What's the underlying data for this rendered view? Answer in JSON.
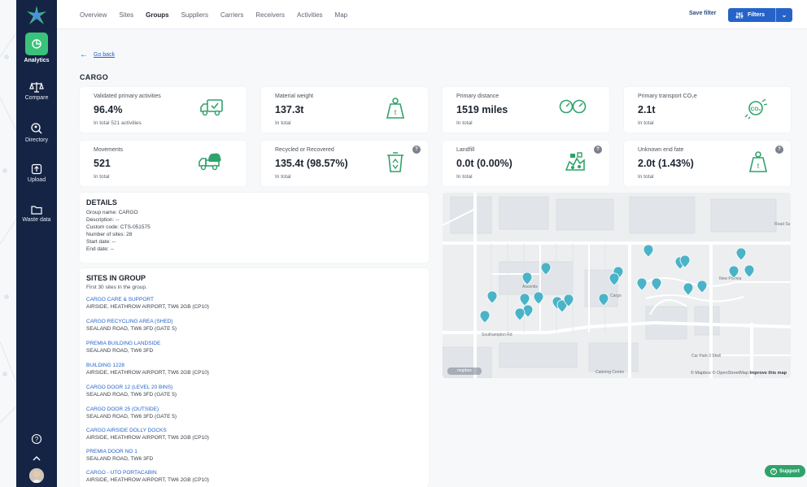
{
  "sidebar": {
    "items": [
      {
        "label": "Analytics",
        "icon": "analytics-icon",
        "active": true
      },
      {
        "label": "Compare",
        "icon": "compare-scale-icon"
      },
      {
        "label": "Directory",
        "icon": "directory-search-icon"
      },
      {
        "label": "Upload",
        "icon": "upload-icon"
      },
      {
        "label": "Waste data",
        "icon": "folder-icon"
      }
    ],
    "help_icon": "help-circle-icon",
    "collapse_icon": "chevron-up-icon"
  },
  "topnav": {
    "tabs": [
      "Overview",
      "Sites",
      "Groups",
      "Suppliers",
      "Carriers",
      "Receivers",
      "Activities",
      "Map"
    ],
    "active_tab": "Groups",
    "save_filter": "Save filter",
    "filters": "Filters"
  },
  "page": {
    "go_back": "Go back",
    "title": "CARGO"
  },
  "kpis": [
    {
      "label": "Validated primary activities",
      "value": "96.4%",
      "sub": "In total 521 activities",
      "icon": "truck-check-icon",
      "help": false
    },
    {
      "label": "Material weight",
      "value": "137.3t",
      "sub": "In total",
      "icon": "weight-icon",
      "help": false
    },
    {
      "label": "Primary distance",
      "value": "1519 miles",
      "sub": "In total",
      "icon": "gauge-icon",
      "help": false
    },
    {
      "label": "Primary transport CO₂e",
      "value": "2.1t",
      "sub": "In total",
      "icon": "co2-icon",
      "help": false
    },
    {
      "label": "Movements",
      "value": "521",
      "sub": "In total",
      "icon": "truck-cargo-icon",
      "help": false
    },
    {
      "label": "Recycled or Recovered",
      "value": "135.4t (98.57%)",
      "sub": "In total",
      "icon": "recycle-bin-icon",
      "help": true
    },
    {
      "label": "Landfill",
      "value": "0.0t (0.00%)",
      "sub": "In total",
      "icon": "landfill-icon",
      "help": true
    },
    {
      "label": "Unknown end fate",
      "value": "2.0t (1.43%)",
      "sub": "In total",
      "icon": "weight-icon",
      "help": true
    }
  ],
  "details": {
    "title": "DETAILS",
    "lines": [
      "Group name: CARGO",
      "Description: --",
      "Custom code: CTS-051575",
      "Number of sites: 28",
      "Start date: --",
      "End date: --"
    ]
  },
  "sites": {
    "title": "SITES IN GROUP",
    "subtitle": "First 30 sites in the group.",
    "items": [
      {
        "name": "CARGO CARE & SUPPORT",
        "address": "AIRSIDE, HEATHROW AIRPORT, TW6 2GB (CP10)"
      },
      {
        "name": "CARGO RECYCLING AREA (SHED)",
        "address": "SEALAND ROAD, TW6 3FD (GATE 5)"
      },
      {
        "name": "PREMIA BUILDING LANDSIDE",
        "address": "SEALAND ROAD, TW6 3FD"
      },
      {
        "name": "BUILDING 1228",
        "address": "AIRSIDE, HEATHROW AIRPORT, TW6 2GB (CP10)"
      },
      {
        "name": "CARGO DOOR 12 (LEVEL 20 BINS)",
        "address": "SEALAND ROAD, TW6 3FD (GATE 5)"
      },
      {
        "name": "CARGO DOOR 25 (OUTSIDE)",
        "address": "SEALAND ROAD, TW6 3FD (GATE 5)"
      },
      {
        "name": "CARGO AIRSIDE DOLLY DOCKS",
        "address": "AIRSIDE, HEATHROW AIRPORT, TW6 2GB (CP10)"
      },
      {
        "name": "PREMIA DOOR NO 1",
        "address": "SEALAND ROAD, TW6 3FD"
      },
      {
        "name": "CARGO - UTO PORTACABIN",
        "address": "AIRSIDE, HEATHROW AIRPORT, TW6 2GB (CP10)"
      }
    ]
  },
  "map": {
    "labels": [
      "Ascentis",
      "Cargo",
      "New Premia",
      "Southampton Rd",
      "Car Park 3 Shell",
      "Catering Centre",
      "Road Su"
    ],
    "attribution_pre": "© Mapbox © OpenStreetMap",
    "attribution_link": "Improve this map",
    "pin_color": "#4bb3c8"
  },
  "support": "Support",
  "colors": {
    "sidebar": "#152445",
    "active": "#3ac27a",
    "primary": "#2563c9",
    "icon_green": "#2fa36b"
  }
}
